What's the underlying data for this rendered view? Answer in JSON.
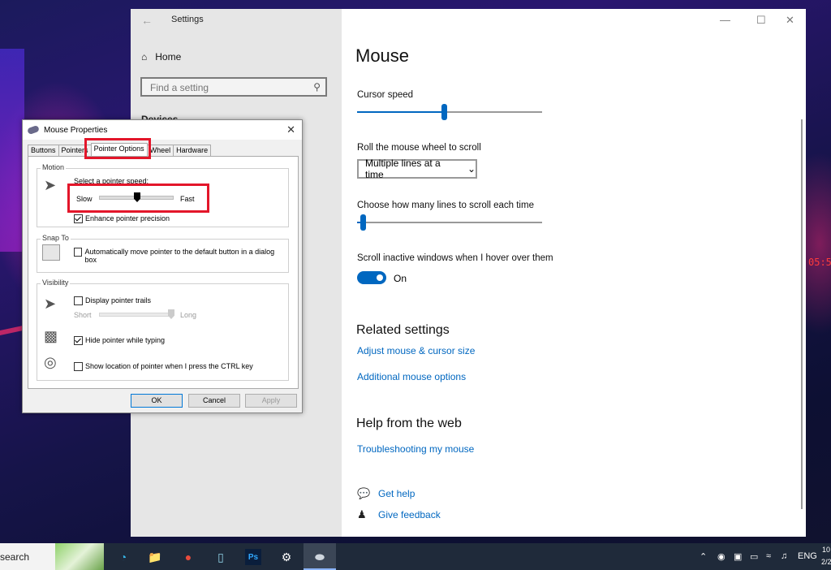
{
  "settings": {
    "window_title": "Settings",
    "nav": {
      "home": "Home",
      "search_placeholder": "Find a setting",
      "section": "Devices"
    },
    "page_title": "Mouse",
    "cursor_speed_label": "Cursor speed",
    "cursor_speed_value": 0.47,
    "scroll_label": "Roll the mouse wheel to scroll",
    "scroll_value": "Multiple lines at a time",
    "lines_label": "Choose how many lines to scroll each time",
    "lines_value": 0.03,
    "inactive_label": "Scroll inactive windows when I hover over them",
    "inactive_state": "On",
    "related_title": "Related settings",
    "related_links": [
      "Adjust mouse & cursor size",
      "Additional mouse options"
    ],
    "help_title": "Help from the web",
    "help_link": "Troubleshooting my mouse",
    "get_help": "Get help",
    "give_feedback": "Give feedback"
  },
  "dialog": {
    "title": "Mouse Properties",
    "tabs": [
      "Buttons",
      "Pointers",
      "Pointer Options",
      "Wheel",
      "Hardware"
    ],
    "active_tab": "Pointer Options",
    "motion": {
      "group": "Motion",
      "label": "Select a pointer speed:",
      "slow": "Slow",
      "fast": "Fast",
      "speed_value": 0.5,
      "precision": "Enhance pointer precision",
      "precision_checked": true
    },
    "snap": {
      "group": "Snap To",
      "label": "Automatically move pointer to the default button in a dialog box",
      "checked": false
    },
    "visibility": {
      "group": "Visibility",
      "trails": "Display pointer trails",
      "trails_checked": false,
      "short": "Short",
      "long": "Long",
      "trails_value": 1.0,
      "hide": "Hide pointer while typing",
      "hide_checked": true,
      "ctrl": "Show location of pointer when I press the CTRL key",
      "ctrl_checked": false
    },
    "buttons": {
      "ok": "OK",
      "cancel": "Cancel",
      "apply": "Apply"
    }
  },
  "taskbar": {
    "search": "search",
    "language": "ENG",
    "time": "10",
    "date": "2/2"
  },
  "desktop_clock": "05:5",
  "colors": {
    "accent": "#0067c0",
    "highlight": "#e3162a"
  }
}
